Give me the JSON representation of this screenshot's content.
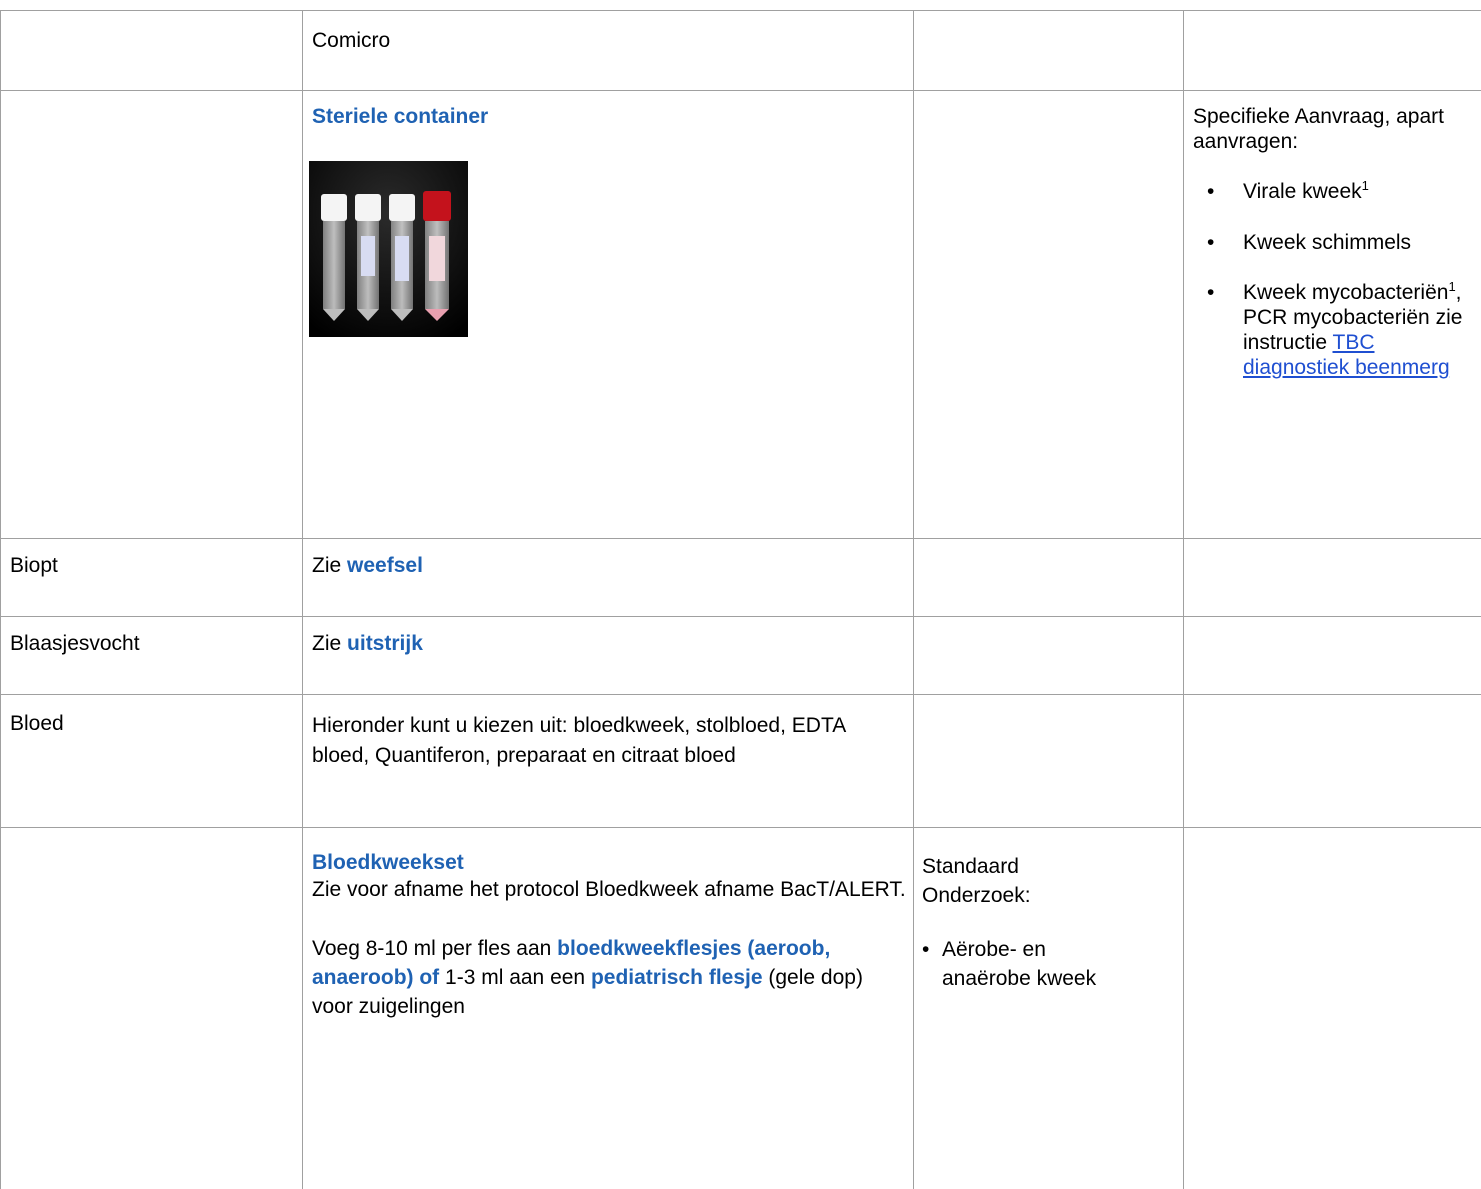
{
  "colors": {
    "accent_text": "#1f62b3",
    "link": "#1f4fd1",
    "border": "#a0a0a0"
  },
  "rows": [
    {
      "c2": "Comicro"
    },
    {
      "c2_title": "Steriele container",
      "image": "sterile-container-tubes-photo",
      "c4_intro": "Specifieke Aanvraag, apart aanvragen:",
      "c4_items": [
        {
          "text": "Virale kweek",
          "sup": "1"
        },
        {
          "text": "Kweek schimmels"
        },
        {
          "text_a": "Kweek mycobacteriën",
          "sup": "1",
          "text_b": ", PCR mycobacteriën zie instructie",
          "link": "TBC diagnostiek beenmerg"
        }
      ]
    },
    {
      "c1": "Biopt",
      "c2_prefix": "Zie",
      "c2_link": "weefsel"
    },
    {
      "c1": "Blaasjesvocht",
      "c2_prefix": "Zie",
      "c2_link": "uitstrijk"
    },
    {
      "c1": "Bloed",
      "c2": "Hieronder kunt u kiezen uit: bloedkweek, stolbloed, EDTA bloed, Quantiferon, preparaat en citraat bloed"
    },
    {
      "c2_title": "Bloedkweekset",
      "c2_line1": "Zie voor afname het protocol Bloedkweek afname BacT/ALERT.",
      "c2_p2_a": "Voeg 8-10 ml per fles aan",
      "c2_p2_b": "bloedkweekflesjes (aeroob, anaeroob) of",
      "c2_p2_c": "1-3 ml  aan een",
      "c2_p2_d": "pediatrisch flesje",
      "c2_p2_e": "(gele dop) voor zuigelingen",
      "c3_title": "Standaard Onderzoek:",
      "c3_items": [
        "Aërobe- en anaërobe kweek"
      ]
    }
  ]
}
